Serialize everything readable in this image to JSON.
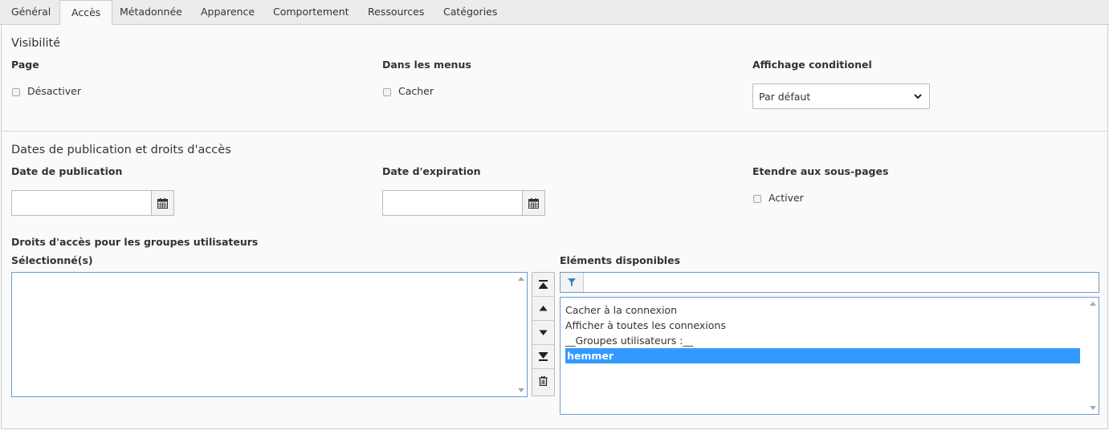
{
  "tabs": [
    {
      "label": "Général"
    },
    {
      "label": "Accès"
    },
    {
      "label": "Métadonnée"
    },
    {
      "label": "Apparence"
    },
    {
      "label": "Comportement"
    },
    {
      "label": "Ressources"
    },
    {
      "label": "Catégories"
    }
  ],
  "active_tab": "Accès",
  "visibility": {
    "title": "Visibilité",
    "page_label": "Page",
    "page_checkbox": "Désactiver",
    "menus_label": "Dans les menus",
    "menus_checkbox": "Cacher",
    "conditional_label": "Affichage conditionel",
    "conditional_value": "Par défaut"
  },
  "publication": {
    "title": "Dates de publication et droits d'accès",
    "pub_date_label": "Date de publication",
    "pub_date_value": "",
    "exp_date_label": "Date d'expiration",
    "exp_date_value": "",
    "extend_label": "Etendre aux sous-pages",
    "extend_checkbox": "Activer"
  },
  "access": {
    "group_label": "Droits d'accès pour les groupes utilisateurs",
    "selected_label": "Sélectionné(s)",
    "available_label": "Eléments disponibles",
    "filter_value": "",
    "available_items": [
      {
        "label": "Cacher à la connexion",
        "selected": false
      },
      {
        "label": "Afficher à toutes les connexions",
        "selected": false
      },
      {
        "label": "__Groupes utilisateurs :__",
        "selected": false
      },
      {
        "label": "hemmer",
        "selected": true
      }
    ]
  },
  "colors": {
    "selection": "#3399ff",
    "focus_border": "#6c9bd2"
  },
  "icons": [
    "calendar-icon",
    "chevron-down-icon",
    "move-top-icon",
    "move-up-icon",
    "move-down-icon",
    "move-bottom-icon",
    "trash-icon",
    "filter-icon"
  ]
}
